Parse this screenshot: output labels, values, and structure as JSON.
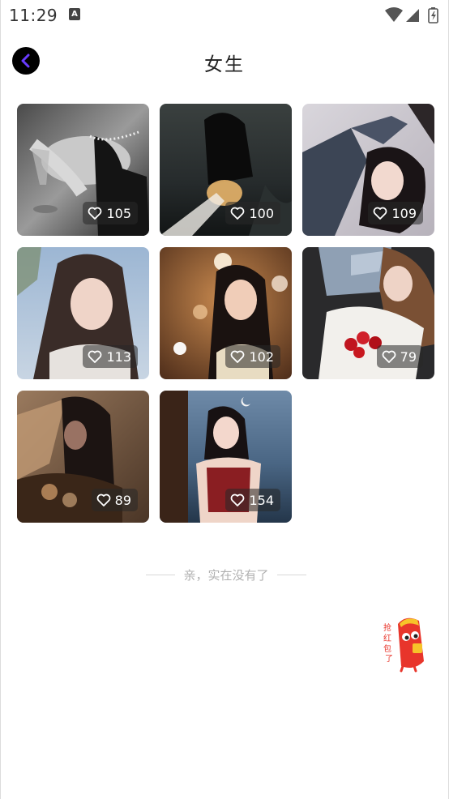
{
  "status_bar": {
    "time": "11:29",
    "notification_icon": "a-letter-icon",
    "wifi_icon": "wifi-icon",
    "signal_icon": "signal-icon",
    "battery_icon": "battery-charging-icon"
  },
  "header": {
    "back_icon": "chevron-left-icon",
    "title": "女生"
  },
  "grid": {
    "items": [
      {
        "likes": "105",
        "photo": "monochrome-portrait"
      },
      {
        "likes": "100",
        "photo": "dark-seaside-portrait"
      },
      {
        "likes": "109",
        "photo": "bed-portrait"
      },
      {
        "likes": "113",
        "photo": "outdoor-blue-sky-portrait"
      },
      {
        "likes": "102",
        "photo": "bokeh-night-portrait"
      },
      {
        "likes": "79",
        "photo": "car-roses-portrait"
      },
      {
        "likes": "89",
        "photo": "blurred-flowers-portrait"
      },
      {
        "likes": "154",
        "photo": "sea-moon-portrait"
      }
    ]
  },
  "footer": {
    "end_text": "亲，实在没有了"
  },
  "floating": {
    "mascot_icon": "red-packet-mascot-icon",
    "mascot_text": "抢红包了",
    "accent": "#e8352b"
  },
  "colors": {
    "back_button_bg": "#000000",
    "back_chevron": "#6a3cff"
  }
}
